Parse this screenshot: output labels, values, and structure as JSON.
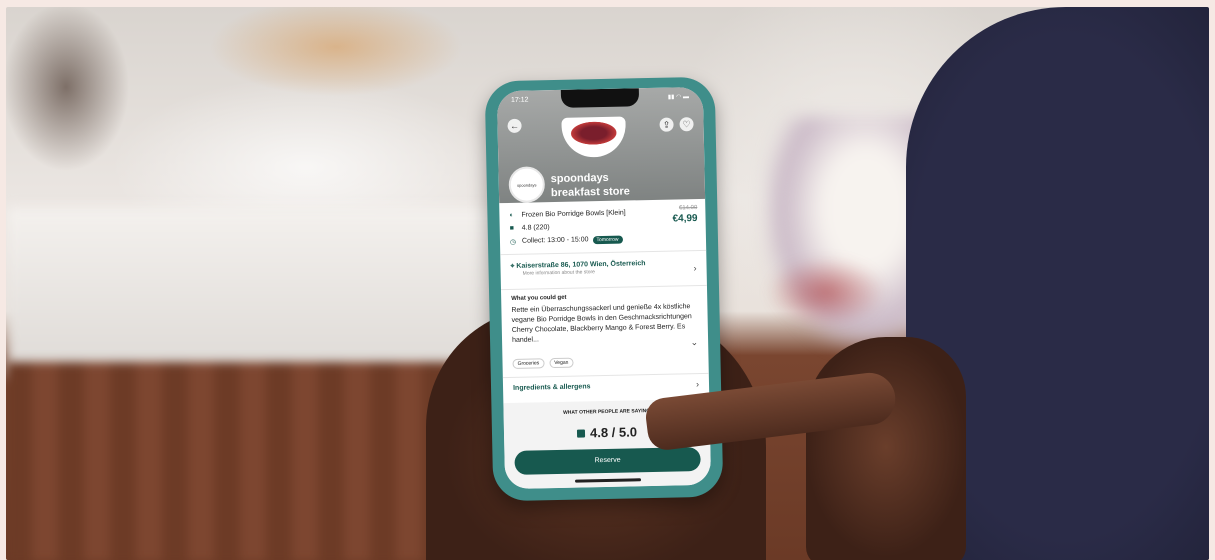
{
  "app": {
    "status": {
      "time": "17:12"
    },
    "store": {
      "name": "spoondays breakfast store",
      "logo_text": "spoondays"
    },
    "product": {
      "name": "Frozen Bio Porridge Bowls [Klein]",
      "price_old": "€14.00",
      "price": "€4,99",
      "rating": "4.8 (220)",
      "collect": "Collect: 13:00 - 15:00",
      "collect_badge": "Tomorrow"
    },
    "address": {
      "line": "Kaiserstraße 86, 1070 Wien, Österreich",
      "more": "More information about the store"
    },
    "description": {
      "heading": "What you could get",
      "text": "Rette ein Überraschungssackerl und genieße 4x köstliche vegane Bio Porridge Bowls in den Geschmacksrichtungen Cherry Chocolate, Blackberry Mango & Forest Berry. Es handel..."
    },
    "tags": [
      "Groceries",
      "Vegan"
    ],
    "ingredients_label": "Ingredients & allergens",
    "reviews": {
      "heading": "WHAT OTHER PEOPLE ARE SAYING",
      "score": "4.8 / 5.0"
    },
    "reserve_label": "Reserve"
  },
  "colors": {
    "brand": "#17594f",
    "phone_case": "#3f8e8a",
    "background": "#f6e9e4"
  }
}
